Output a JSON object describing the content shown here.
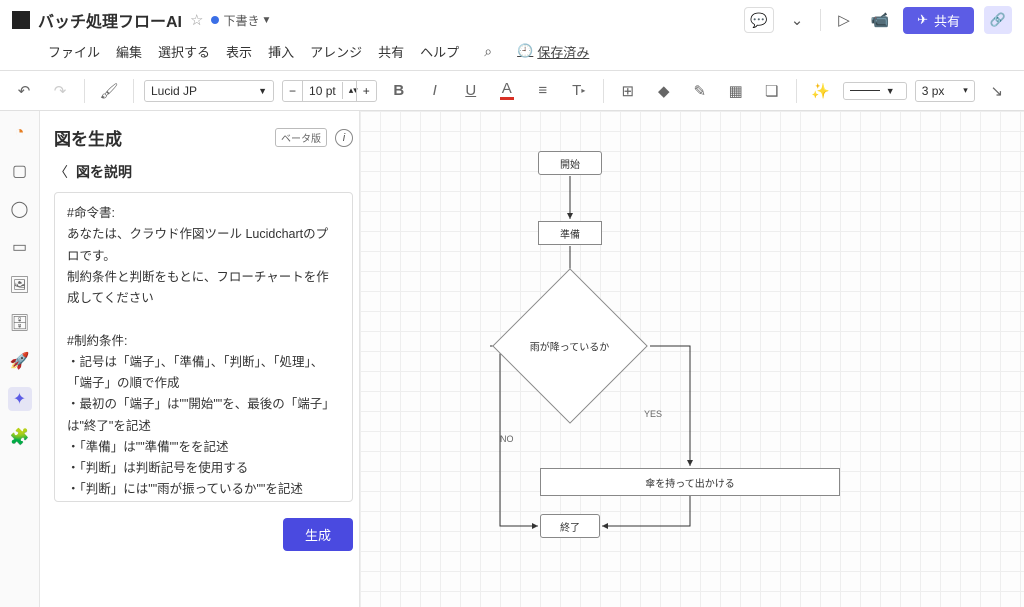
{
  "header": {
    "doc_title": "バッチ処理フローAI",
    "draft_label": "下書き"
  },
  "header_right": {
    "share_label": "共有"
  },
  "menu": {
    "file": "ファイル",
    "edit": "編集",
    "select": "選択する",
    "view": "表示",
    "insert": "挿入",
    "arrange": "アレンジ",
    "share": "共有",
    "help": "ヘルプ",
    "saved": "保存済み"
  },
  "toolbar": {
    "font": "Lucid JP",
    "font_size": "10 pt",
    "line_width": "3 px"
  },
  "panel": {
    "title": "図を生成",
    "beta": "ベータ版",
    "sub_title": "図を説明",
    "generate_btn": "生成",
    "prompt_text": "#命令書:\nあなたは、クラウド作図ツール Lucidchartのプロです。\n制約条件と判断をもとに、フローチャートを作成してください\n\n#制約条件:\n・記号は「端子」、「準備」、「判断」、「処理」、「端子」の順で作成\n・最初の「端子」は\"\"開始\"\"を、最後の「端子」は\"終了\"を記述\n・「準備」は\"\"準備\"\"をを記述\n・「判断」は判断記号を使用する\n・「判断」には\"\"雨が振っているか\"\"を記述\n・「処理」は\"\"傘を持って出かける\"\"を記述"
  },
  "flow": {
    "start": "開始",
    "prep": "準備",
    "decision": "雨が降っているか",
    "yes": "YES",
    "no": "NO",
    "process": "傘を持って出かける",
    "end": "終了"
  }
}
